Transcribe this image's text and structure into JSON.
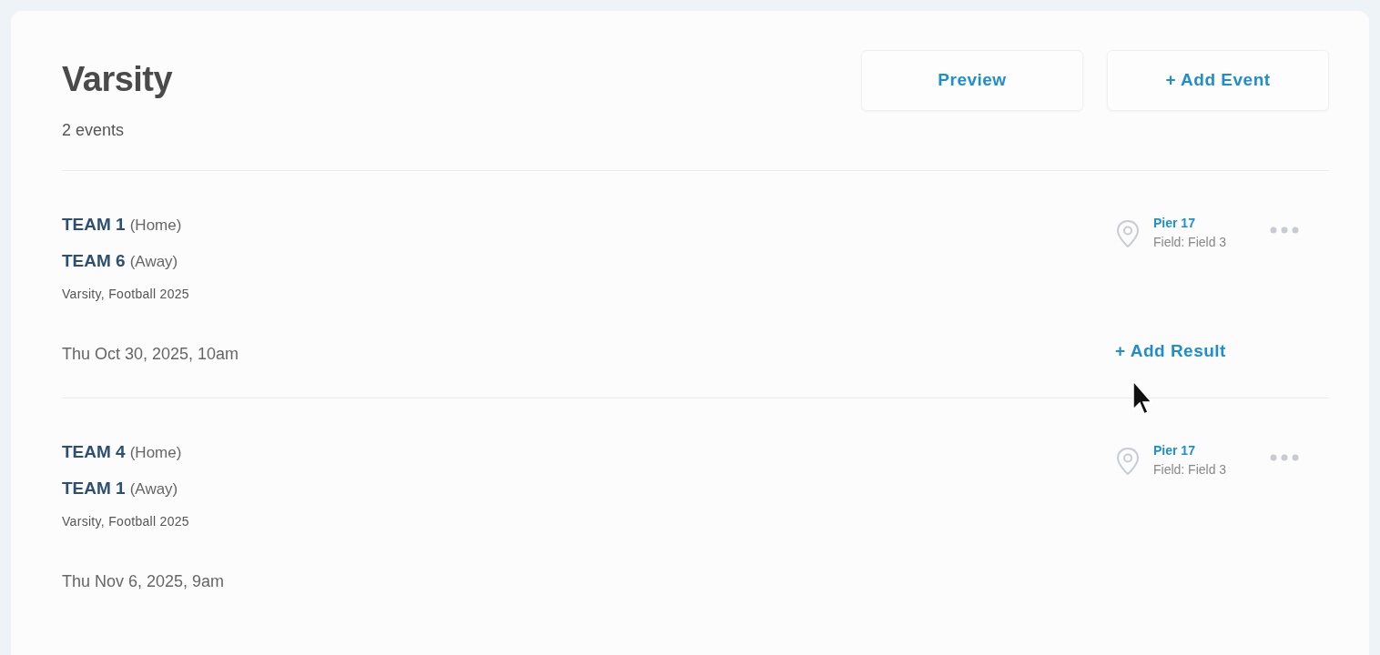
{
  "header": {
    "title": "Varsity",
    "count": "2 events"
  },
  "buttons": [
    {
      "label": "Preview"
    },
    {
      "label": "+ Add Event"
    }
  ],
  "events": [
    {
      "teams": [
        {
          "name": "TEAM 1",
          "side": "(Home)"
        },
        {
          "name": "TEAM 6",
          "side": "(Away)"
        }
      ],
      "subtitle": "Varsity, Football 2025",
      "date": "Thu Oct 30, 2025, 10am",
      "venue": "Pier 17",
      "field": "Field: Field 3",
      "action": "+ Add Result"
    },
    {
      "teams": [
        {
          "name": "TEAM 4",
          "side": "(Home)"
        },
        {
          "name": "TEAM 1",
          "side": "(Away)"
        }
      ],
      "subtitle": "Varsity, Football 2025",
      "date": "Thu Nov 6, 2025, 9am",
      "venue": "Pier 17",
      "field": "Field: Field 3"
    }
  ]
}
